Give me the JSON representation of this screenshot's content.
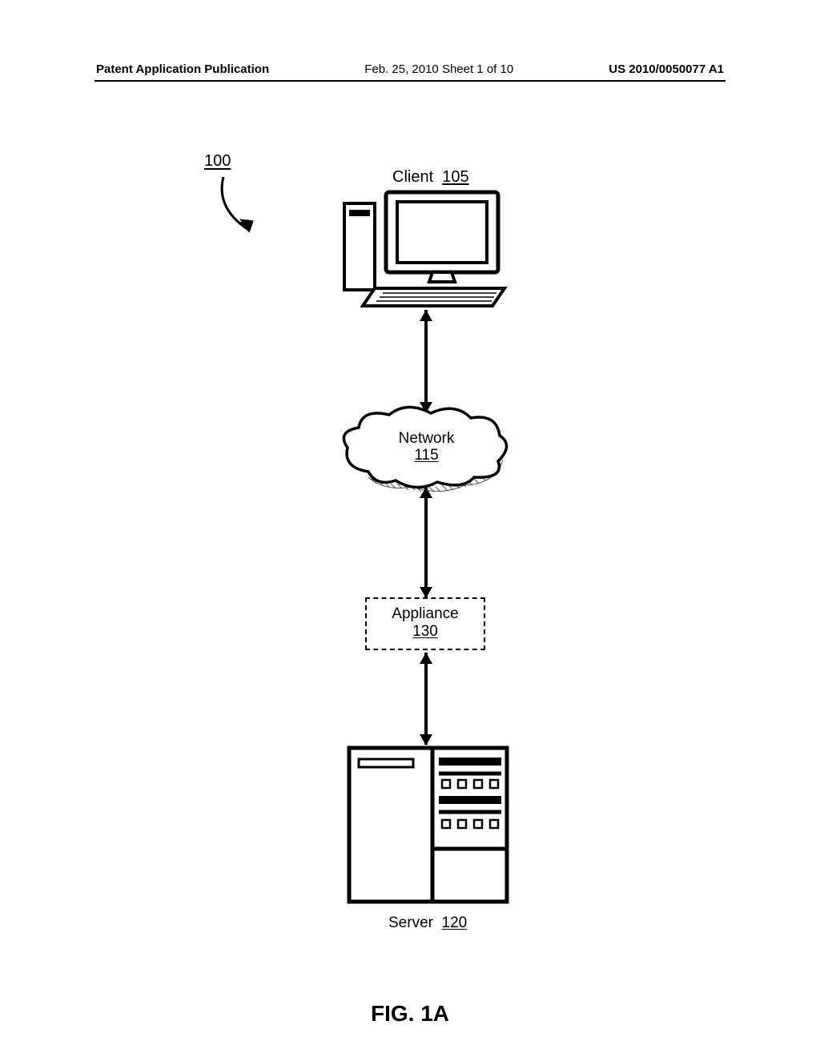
{
  "header": {
    "left": "Patent Application Publication",
    "center": "Feb. 25, 2010  Sheet 1 of 10",
    "right": "US 2010/0050077 A1"
  },
  "system_ref": "100",
  "client": {
    "label": "Client",
    "ref": "105"
  },
  "network": {
    "label": "Network",
    "ref": "115"
  },
  "appliance": {
    "label": "Appliance",
    "ref": "130"
  },
  "server": {
    "label": "Server",
    "ref": "120"
  },
  "figure_label": "FIG. 1A"
}
